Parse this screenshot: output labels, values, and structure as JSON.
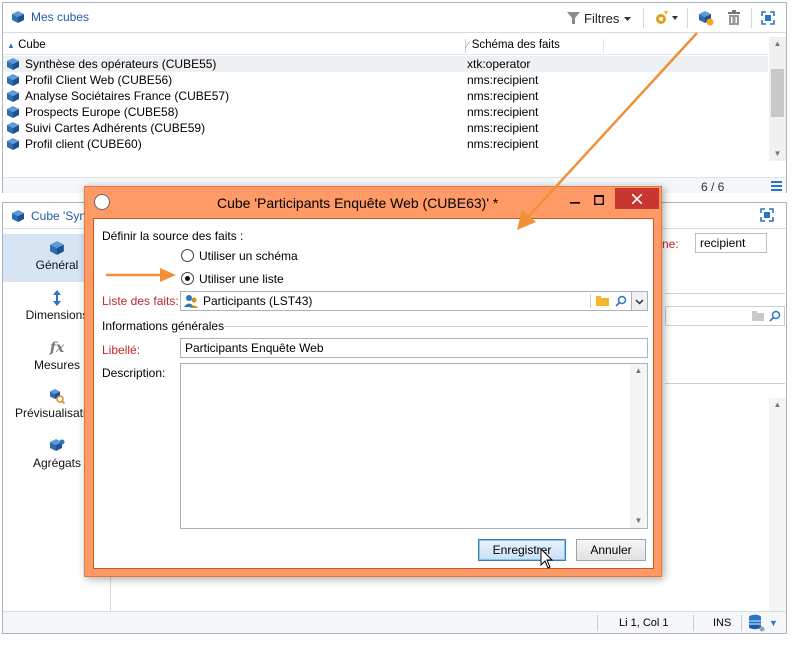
{
  "top_panel": {
    "title": "Mes cubes",
    "filters_label": "Filtres",
    "columns": {
      "cube": "Cube",
      "schema": "Schéma des faits"
    },
    "rows": [
      {
        "label": "Synthèse des opérateurs (CUBE55)",
        "schema": "xtk:operator"
      },
      {
        "label": "Profil Client Web (CUBE56)",
        "schema": "nms:recipient"
      },
      {
        "label": "Analyse Sociétaires France (CUBE57)",
        "schema": "nms:recipient"
      },
      {
        "label": "Prospects Europe (CUBE58)",
        "schema": "nms:recipient"
      },
      {
        "label": "Suivi Cartes Adhérents (CUBE59)",
        "schema": "nms:recipient"
      },
      {
        "label": "Profil client (CUBE60)",
        "schema": "nms:recipient"
      }
    ],
    "count": "6 / 6"
  },
  "bottom_panel": {
    "title": "Cube 'Syn",
    "nav": [
      {
        "label": "Général"
      },
      {
        "label": "Dimensions"
      },
      {
        "label": "Mesures"
      },
      {
        "label": "Prévisualisation"
      },
      {
        "label": "Agrégats"
      }
    ],
    "right_label": "rne:",
    "right_value": "recipient",
    "status": {
      "position": "Li 1, Col 1",
      "mode": "INS"
    }
  },
  "dialog": {
    "title": "Cube 'Participants Enquête Web (CUBE63)' *",
    "source_label": "Définir la source des faits :",
    "radio_schema": "Utiliser un schéma",
    "radio_list": "Utiliser une liste",
    "facts_list_label": "Liste des faits:",
    "facts_list_value": "Participants (LST43)",
    "general_info": "Informations générales",
    "label_label": "Libellé:",
    "label_value": "Participants Enquête Web",
    "description_label": "Description:",
    "save_button": "Enregistrer",
    "cancel_button": "Annuler"
  },
  "colors": {
    "accent": "#1e5aa8",
    "dialog_frame": "#ff9966",
    "close_button": "#c7372f",
    "required_label": "#c0262b",
    "annotation_arrow": "#f0913a"
  }
}
